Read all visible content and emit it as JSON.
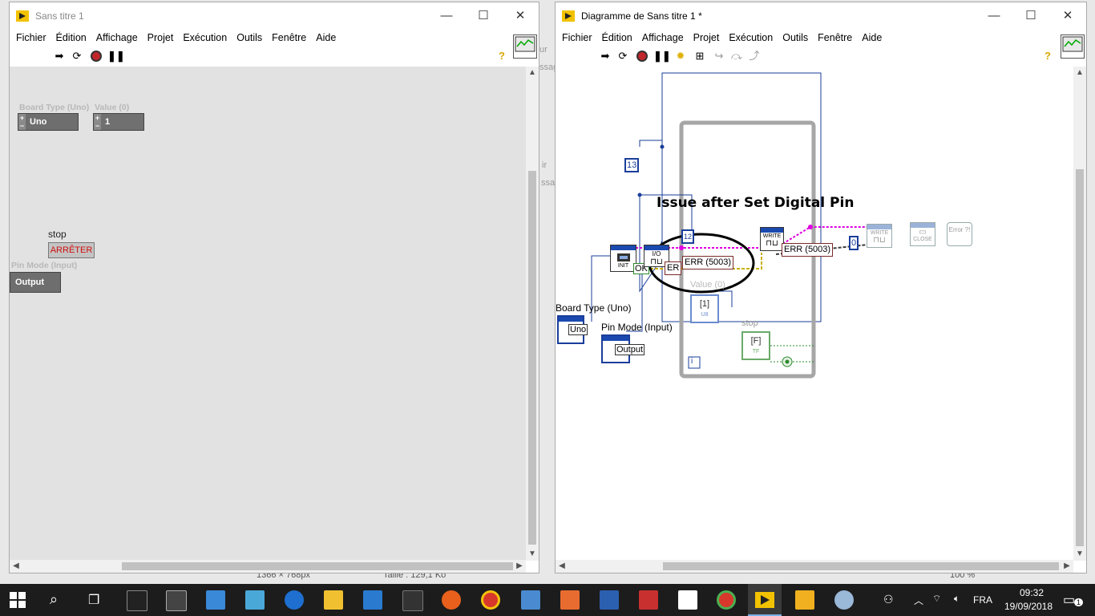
{
  "colors": {
    "labview_yellow": "#f2c200",
    "wire_blue": "#1a3e9a",
    "wire_pink": "#e000e0",
    "wire_yellow": "#d8c000",
    "error_red": "#c00000",
    "taskbar": "#1c1c1c"
  },
  "front_panel": {
    "title": "Sans titre 1",
    "menu": [
      "Fichier",
      "Édition",
      "Affichage",
      "Projet",
      "Exécution",
      "Outils",
      "Fenêtre",
      "Aide"
    ],
    "controls": {
      "board_type_label": "Board Type (Uno)",
      "board_type_value": "Uno",
      "value_label": "Value (0)",
      "value_value": "1",
      "stop_label": "stop",
      "stop_button": "ARRÊTER",
      "pin_mode_label": "Pin Mode (Input)",
      "pin_mode_value": "Output"
    }
  },
  "block_diagram": {
    "title": "Diagramme de Sans titre 1 *",
    "menu": [
      "Fichier",
      "Édition",
      "Affichage",
      "Projet",
      "Exécution",
      "Outils",
      "Fenêtre",
      "Aide"
    ],
    "annotation": "Issue after Set Digital Pin",
    "constants": {
      "pin13": "13",
      "pin12": "12",
      "zero": "0",
      "err1": "ERR (5003)",
      "err2": "ERR (5003)",
      "err_partial": "ER",
      "ok": "OK",
      "board_type_label": "Board Type (Uno)",
      "board_type_value": "Uno",
      "pin_mode_label": "Pin Mode (Input)",
      "pin_mode_value": "Output",
      "value_label": "Value (0)",
      "value_terminal": "U8",
      "stop_label": "stop",
      "stop_terminal": "TF",
      "loop_index": "i"
    },
    "vi_labels": {
      "init": "INIT",
      "write1": "WRITE",
      "write2": "WRITE",
      "close": "CLOSE",
      "error": "Error ?!"
    }
  },
  "background_fragments": {
    "frag1": "ur",
    "frag2": "ssag",
    "frag3": "ir",
    "frag4": "ssa",
    "status1": "1366 × 768px",
    "status2": "Taille : 129,1 Ko",
    "zoom": "100 %"
  },
  "taskbar": {
    "language": "FRA",
    "time": "09:32",
    "date": "19/09/2018",
    "notification_count": "1",
    "apps": [
      "start",
      "search",
      "task-view",
      "cmd",
      "calculator",
      "app-blue",
      "app-cloud",
      "edge",
      "explorer",
      "store",
      "app-dark",
      "firefox",
      "chrome",
      "app-drive",
      "app-orange",
      "word",
      "app-red",
      "app-note",
      "chrome-2",
      "labview",
      "app-yellow",
      "app-paint"
    ]
  }
}
